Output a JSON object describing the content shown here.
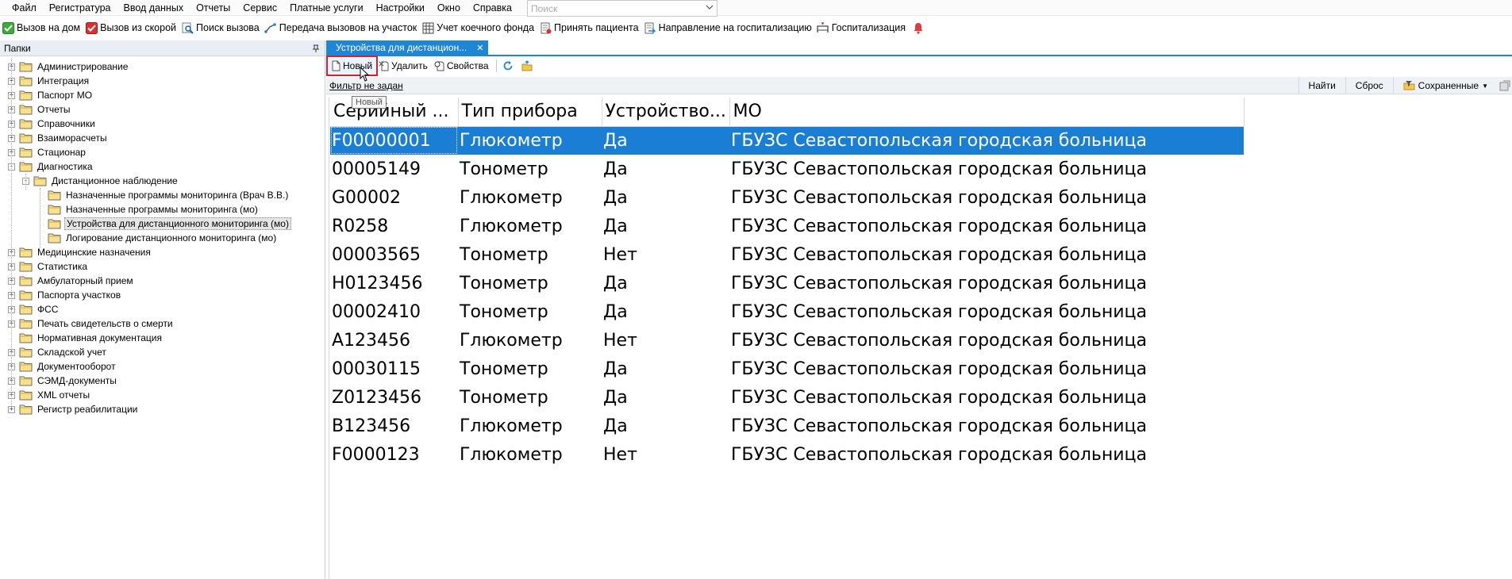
{
  "menu": [
    "Файл",
    "Регистратура",
    "Ввод данных",
    "Отчеты",
    "Сервис",
    "Платные услуги",
    "Настройки",
    "Окно",
    "Справка"
  ],
  "search": {
    "placeholder": "Поиск"
  },
  "quickbar": [
    {
      "label": "Вызов на дом",
      "icon": "green-check-icon"
    },
    {
      "label": "Вызов из скорой",
      "icon": "red-check-icon"
    },
    {
      "label": "Поиск вызова",
      "icon": "search-doc-icon"
    },
    {
      "label": "Передача вызовов на участок",
      "icon": "transfer-icon"
    },
    {
      "label": "Учет коечного фонда",
      "icon": "table-icon"
    },
    {
      "label": "Принять пациента",
      "icon": "accept-doc-icon"
    },
    {
      "label": "Направление на госпитализацию",
      "icon": "referral-icon"
    },
    {
      "label": "Госпитализация",
      "icon": "hospitalization-icon"
    }
  ],
  "folders": {
    "title": "Папки",
    "items": [
      {
        "label": "Администрирование",
        "level": 0,
        "expander": "+"
      },
      {
        "label": "Интеграция",
        "level": 0,
        "expander": "+"
      },
      {
        "label": "Паспорт МО",
        "level": 0,
        "expander": "+"
      },
      {
        "label": "Отчеты",
        "level": 0,
        "expander": "+"
      },
      {
        "label": "Справочники",
        "level": 0,
        "expander": "+"
      },
      {
        "label": "Взаиморасчеты",
        "level": 0,
        "expander": "+"
      },
      {
        "label": "Стационар",
        "level": 0,
        "expander": "+"
      },
      {
        "label": "Диагностика",
        "level": 0,
        "expander": "-"
      },
      {
        "label": "Дистанционное наблюдение",
        "level": 1,
        "expander": "-"
      },
      {
        "label": "Назначенные программы мониторинга (Врач В.В.)",
        "level": 2,
        "expander": ""
      },
      {
        "label": "Назначенные программы мониторинга (мо)",
        "level": 2,
        "expander": ""
      },
      {
        "label": "Устройства для дистанционного мониторинга (мо)",
        "level": 2,
        "expander": "",
        "selected": true
      },
      {
        "label": "Логирование дистанционного мониторинга (мо)",
        "level": 2,
        "expander": ""
      },
      {
        "label": "Медицинские назначения",
        "level": 0,
        "expander": "+"
      },
      {
        "label": "Статистика",
        "level": 0,
        "expander": "+"
      },
      {
        "label": "Амбулаторный прием",
        "level": 0,
        "expander": "+"
      },
      {
        "label": "Паспорта участков",
        "level": 0,
        "expander": "+"
      },
      {
        "label": "ФСС",
        "level": 0,
        "expander": "+"
      },
      {
        "label": "Печать свидетельств о смерти",
        "level": 0,
        "expander": "+"
      },
      {
        "label": "Нормативная документация",
        "level": 0,
        "expander": ""
      },
      {
        "label": "Складской учет",
        "level": 0,
        "expander": "+"
      },
      {
        "label": "Документооборот",
        "level": 0,
        "expander": "+"
      },
      {
        "label": "СЭМД-документы",
        "level": 0,
        "expander": "+"
      },
      {
        "label": "XML отчеты",
        "level": 0,
        "expander": "+"
      },
      {
        "label": "Регистр реабилитации",
        "level": 0,
        "expander": "+"
      }
    ]
  },
  "tab": {
    "label": "Устройства для дистанцион..."
  },
  "toolbar": {
    "new_label": "Новый",
    "delete_label": "Удалить",
    "properties_label": "Свойства"
  },
  "filter": {
    "link": "Фильтр не задан",
    "find": "Найти",
    "reset": "Сброс",
    "saved": "Сохраненные"
  },
  "tooltip": "Новый",
  "grid": {
    "columns": [
      "Серийный ...",
      "Тип прибора",
      "Устройство...",
      "МО"
    ],
    "rows": [
      [
        "F00000001",
        "Глюкометр",
        "Да",
        "ГБУЗС Севастопольская городская больница"
      ],
      [
        "00005149",
        "Тонометр",
        "Да",
        "ГБУЗС Севастопольская городская больница"
      ],
      [
        "G00002",
        "Глюкометр",
        "Да",
        "ГБУЗС Севастопольская городская больница"
      ],
      [
        "R0258",
        "Глюкометр",
        "Да",
        "ГБУЗС Севастопольская городская больница"
      ],
      [
        "00003565",
        "Тонометр",
        "Нет",
        "ГБУЗС Севастопольская городская больница"
      ],
      [
        "H0123456",
        "Тонометр",
        "Да",
        "ГБУЗС Севастопольская городская больница"
      ],
      [
        "00002410",
        "Тонометр",
        "Да",
        "ГБУЗС Севастопольская городская больница"
      ],
      [
        "A123456",
        "Глюкометр",
        "Нет",
        "ГБУЗС Севастопольская городская больница"
      ],
      [
        "00030115",
        "Тонометр",
        "Да",
        "ГБУЗС Севастопольская городская больница"
      ],
      [
        "Z0123456",
        "Тонометр",
        "Да",
        "ГБУЗС Севастопольская городская больница"
      ],
      [
        "B123456",
        "Глюкометр",
        "Да",
        "ГБУЗС Севастопольская городская больница"
      ],
      [
        "F0000123",
        "Глюкометр",
        "Нет",
        "ГБУЗС Севастопольская городская больница"
      ]
    ],
    "selected_row": 0
  },
  "colors": {
    "accent": "#1f86d6",
    "selection": "#1a7fd4",
    "highlight_border": "#d6202b"
  }
}
